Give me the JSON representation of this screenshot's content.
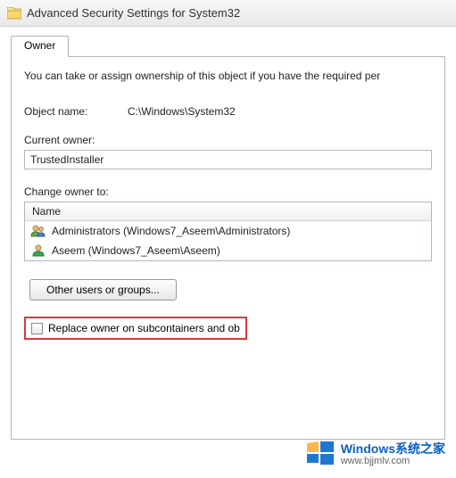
{
  "window": {
    "title": "Advanced Security Settings for System32"
  },
  "tabs": {
    "owner": "Owner"
  },
  "panel": {
    "intro": "You can take or assign ownership of this object if you have the required per",
    "object_name_label": "Object name:",
    "object_name_value": "C:\\Windows\\System32",
    "current_owner_label": "Current owner:",
    "current_owner_value": "TrustedInstaller",
    "change_owner_label": "Change owner to:",
    "list_header": "Name",
    "owners": [
      {
        "type": "group",
        "label": "Administrators (Windows7_Aseem\\Administrators)"
      },
      {
        "type": "user",
        "label": "Aseem (Windows7_Aseem\\Aseem)"
      }
    ],
    "other_users_button": "Other users or groups...",
    "replace_checkbox_label": "Replace owner on subcontainers and ob"
  },
  "watermark": {
    "title": "Windows系统之家",
    "url": "www.bjjmlv.com"
  }
}
